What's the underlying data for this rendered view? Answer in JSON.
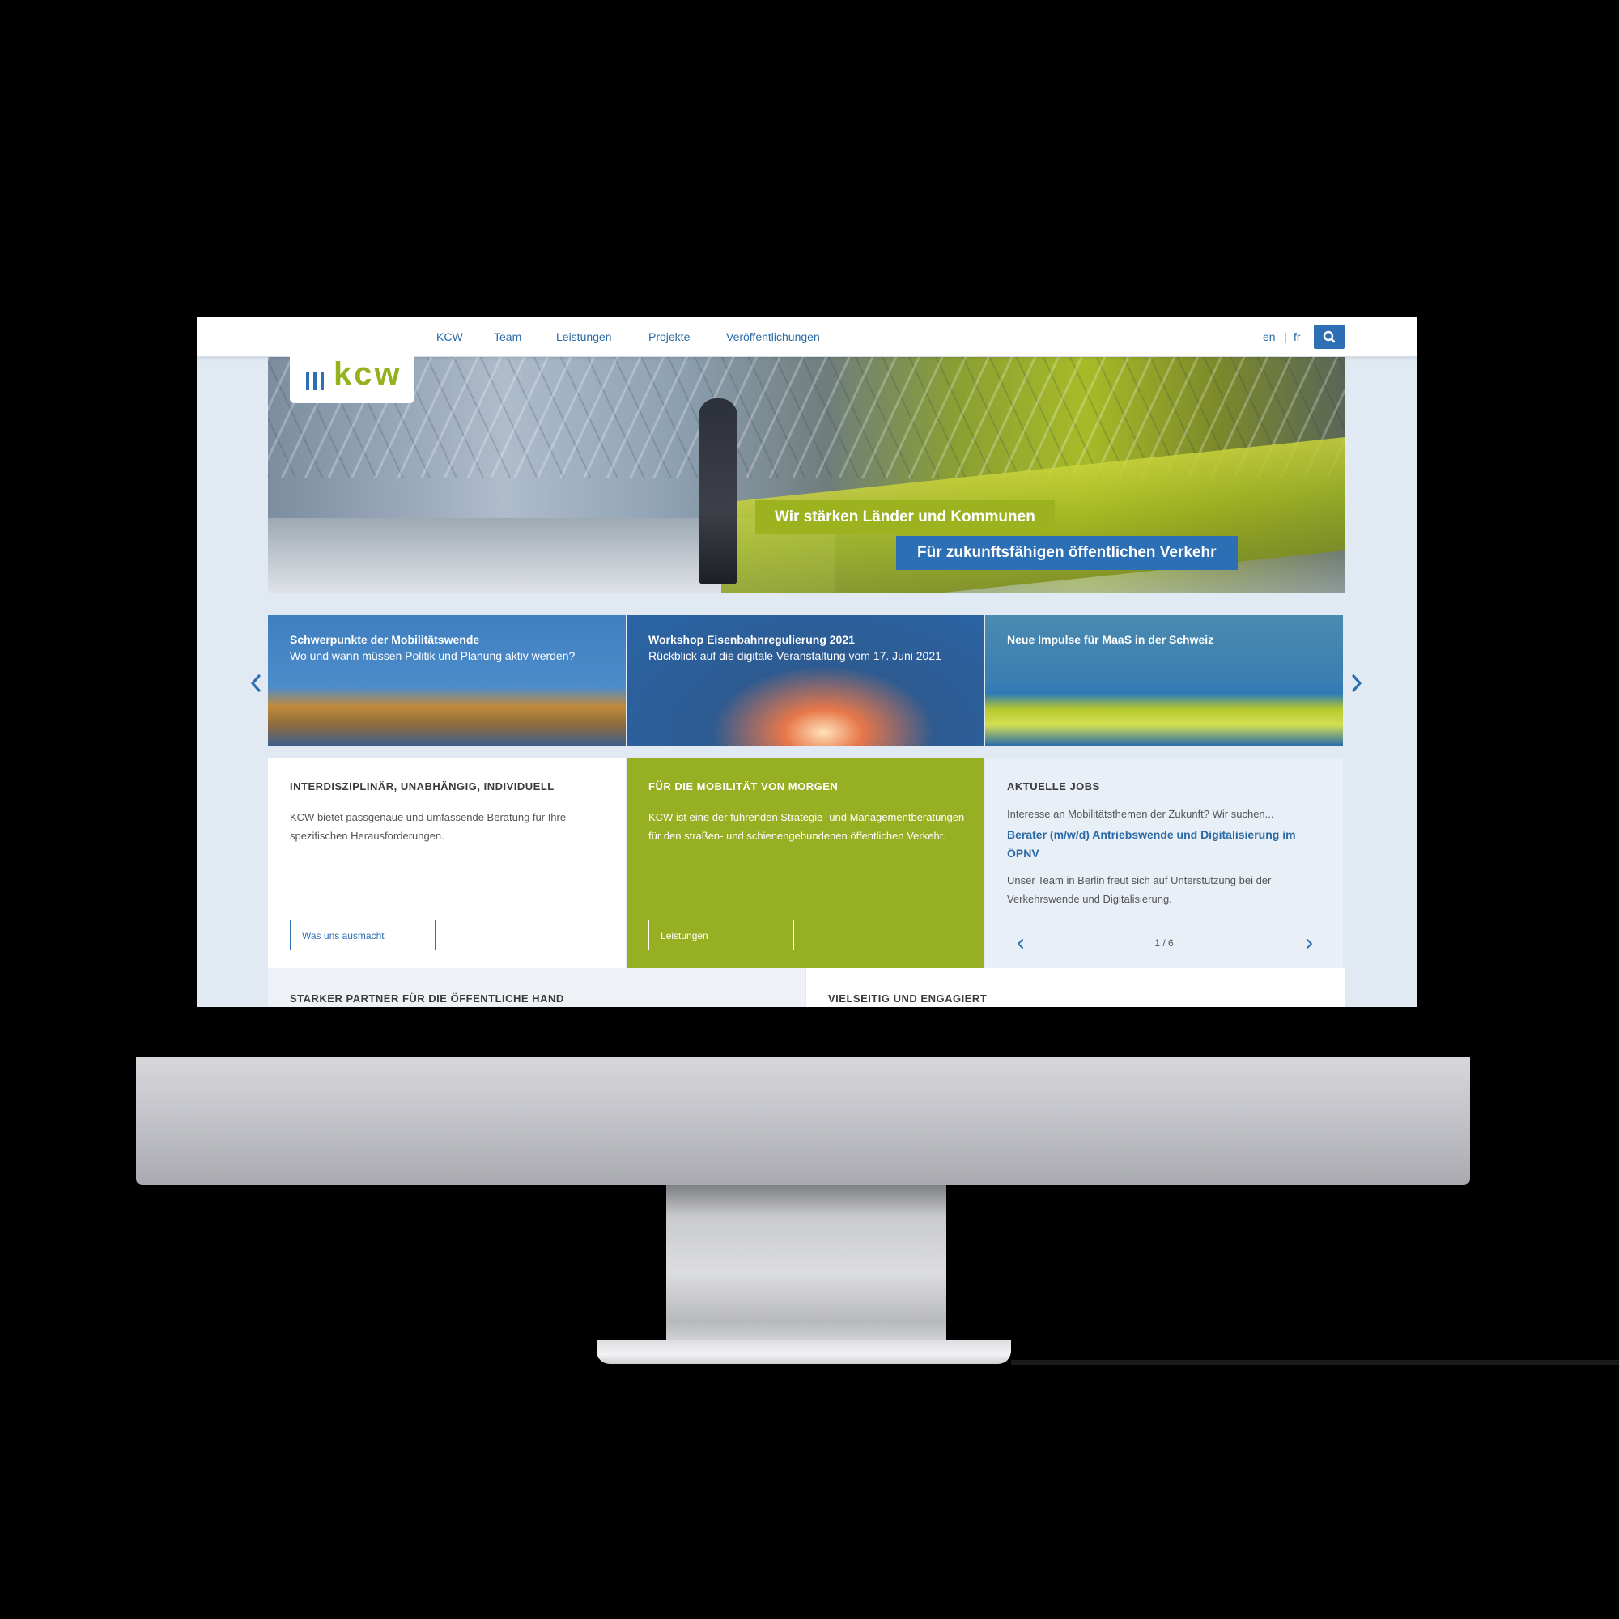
{
  "nav": {
    "items": [
      "KCW",
      "Team",
      "Leistungen",
      "Projekte",
      "Veröffentlichungen"
    ],
    "lang_en": "en",
    "lang_sep": "|",
    "lang_fr": "fr",
    "search_icon": "search-icon"
  },
  "logo": {
    "text": "kcw"
  },
  "hero": {
    "label_primary": "Wir stärken Länder und Kommunen",
    "label_secondary": "Für zukunftsfähigen öffentlichen Verkehr"
  },
  "carousel": {
    "slides": [
      {
        "title": "Schwerpunkte der Mobilitätswende",
        "subtitle": "Wo und wann müssen Politik und Planung aktiv werden?"
      },
      {
        "title": "Workshop Eisenbahnregulierung 2021",
        "subtitle": "Rückblick auf die digitale Veranstaltung vom 17. Juni 2021"
      },
      {
        "title": "Neue Impulse für MaaS in der Schweiz",
        "subtitle": ""
      }
    ]
  },
  "boxes": {
    "about": {
      "title": "INTERDISZIPLINÄR, UNABHÄNGIG, INDIVIDUELL",
      "text": "KCW bietet passgenaue und umfassende Beratung für Ihre spezifischen Herausforderungen.",
      "button": "Was uns ausmacht"
    },
    "mobility": {
      "title": "FÜR DIE MOBILITÄT VON MORGEN",
      "text": "KCW ist eine der führenden Strategie- und Managementberatungen für den straßen- und schienengebundenen öffentlichen Verkehr.",
      "button": "Leistungen"
    },
    "jobs": {
      "title": "AKTUELLE JOBS",
      "intro": "Interesse an Mobilitätsthemen der Zukunft? Wir suchen...",
      "link": "Berater (m/w/d) Antriebswende und Digitalisierung im ÖPNV",
      "text": "Unser Team in Berlin freut sich auf Unterstützung bei der Verkehrswende und Digitalisierung.",
      "pager": "1 / 6"
    }
  },
  "bottom": {
    "left_title": "STARKER PARTNER FÜR DIE ÖFFENTLICHE HAND",
    "right_title": "VIELSEITIG UND ENGAGIERT"
  },
  "colors": {
    "brand_blue": "#2d6fb5",
    "brand_green": "#97af23"
  }
}
